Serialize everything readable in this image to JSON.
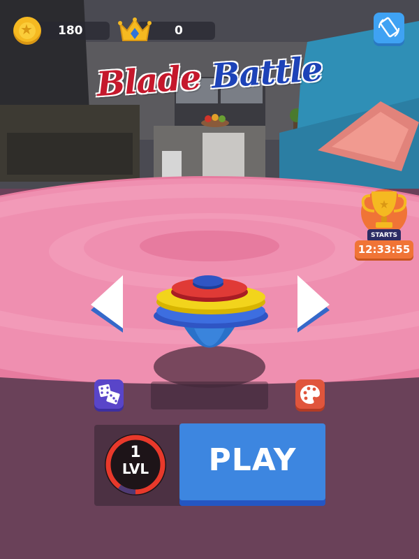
{
  "hud": {
    "coins": "180",
    "crowns": "0",
    "coin_icon": "coin-icon",
    "crown_icon": "crown-icon",
    "rotate_icon": "screen-rotate-icon"
  },
  "title": {
    "word1": "Blade",
    "word2": "Battle"
  },
  "tournament": {
    "starts_label": "STARTS",
    "timer": "12:33:55",
    "icon": "trophy-icon"
  },
  "controls": {
    "prev_icon": "arrow-left-icon",
    "next_icon": "arrow-right-icon",
    "random_icon": "dice-icon",
    "skin_icon": "palette-icon"
  },
  "level": {
    "number": "1",
    "label": "LVL",
    "progress": 0.1
  },
  "play": {
    "label": "PLAY"
  },
  "colors": {
    "arena_pink": "#ef8fb0",
    "floor": "#6a4159",
    "play_blue": "#3d86e0",
    "level_ring": "#e8392b",
    "accent_orange": "#f07436"
  }
}
